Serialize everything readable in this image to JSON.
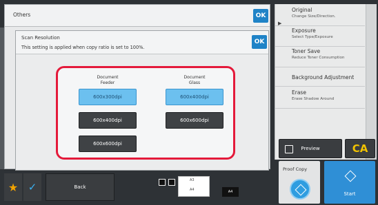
{
  "sidebar": {
    "items": [
      {
        "title": "Original",
        "subtitle": "Change Size/Direction."
      },
      {
        "title": "Exposure",
        "subtitle": "Select Type/Exposure"
      },
      {
        "title": "Toner Save",
        "subtitle": "Reduce Toner Consumption"
      },
      {
        "title": "Background Adjustment",
        "subtitle": ""
      },
      {
        "title": "Erase",
        "subtitle": "Erase Shadow Around"
      }
    ]
  },
  "others_dialog": {
    "title": "Others",
    "ok_label": "OK"
  },
  "scan_dialog": {
    "title": "Scan Resolution",
    "description": "This setting is applied when copy ratio is set to 100%.",
    "ok_label": "OK",
    "document_feeder": {
      "label_line1": "Document",
      "label_line2": "Feeder",
      "options": [
        "600x300dpi",
        "600x400dpi",
        "600x600dpi"
      ],
      "selected": "600x300dpi"
    },
    "document_glass": {
      "label_line1": "Document",
      "label_line2": "Glass",
      "options": [
        "600x400dpi",
        "600x600dpi"
      ],
      "selected": "600x400dpi"
    }
  },
  "bottom": {
    "preview_label": "Preview",
    "ca_label": "CA",
    "proof_copy_label": "Proof Copy",
    "start_label": "Start",
    "back_label": "Back",
    "paper_size": "A4",
    "tray_labels": [
      "A3",
      "A4"
    ]
  },
  "colors": {
    "accent": "#1f83c7",
    "highlight_border": "#e4193a",
    "selected_option": "#6cc0ef",
    "ca_text": "#f2c300"
  },
  "icons": {
    "favorite": "star-icon",
    "check": "check-icon",
    "preview": "preview-icon",
    "proof": "diamond-icon",
    "start": "diamond-icon"
  }
}
